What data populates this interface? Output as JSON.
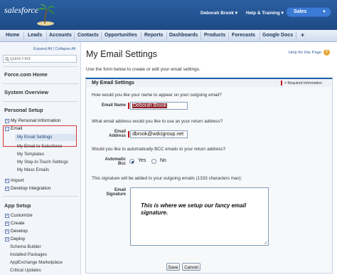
{
  "header": {
    "logo_text": "salesforce",
    "user_menu": "Deborah Brook",
    "help_menu": "Help & Training",
    "app_switcher": "Sales"
  },
  "tabs": [
    {
      "label": "Home"
    },
    {
      "label": "Leads"
    },
    {
      "label": "Accounts"
    },
    {
      "label": "Contacts"
    },
    {
      "label": "Opportunities"
    },
    {
      "label": "Reports"
    },
    {
      "label": "Dashboards"
    },
    {
      "label": "Products"
    },
    {
      "label": "Forecasts"
    },
    {
      "label": "Google Docs"
    },
    {
      "label": "+"
    }
  ],
  "sidebar": {
    "expand_all": "Expand All",
    "collapse_all": "Collapse All",
    "search_placeholder": "Quick Find",
    "sections": {
      "forcecom_home": "Force.com Home",
      "system_overview": "System Overview",
      "personal_setup": "Personal Setup",
      "app_setup": "App Setup"
    },
    "personal_items": {
      "my_personal_information": "My Personal Information",
      "email": "Email",
      "my_email_settings": "My Email Settings",
      "my_email_to_salesforce": "My Email to Salesforce",
      "my_templates": "My Templates",
      "my_stay_in_touch_settings": "My Stay-in-Touch Settings",
      "my_mass_emails": "My Mass Emails",
      "import": "Import",
      "desktop_integration": "Desktop Integration"
    },
    "app_items": {
      "customize": "Customize",
      "create": "Create",
      "develop": "Develop",
      "deploy": "Deploy",
      "schema_builder": "Schema Builder",
      "installed_packages": "Installed Packages",
      "appexchange_marketplace": "AppExchange Marketplace",
      "critical_updates": "Critical Updates"
    }
  },
  "main": {
    "title": "My Email Settings",
    "help_link": "Help for this Page",
    "intro": "Use the form below to create or edit your email settings.",
    "panel_title": "My Email Settings",
    "required_info": "= Required Information",
    "q_name": "How would you like your name to appear on your outgoing email?",
    "email_name_label": "Email Name",
    "email_name_value": "Deborah Brook",
    "q_address": "What email address would you like to use as your return address?",
    "email_address_label_1": "Email",
    "email_address_label_2": "Address",
    "email_address_value": "dbrook@wdcigroup.net",
    "q_bcc": "Would you like to automatically BCC emails to your return address?",
    "auto_bcc_label_1": "Automatic",
    "auto_bcc_label_2": "Bcc",
    "bcc_yes": "Yes",
    "bcc_no": "No",
    "bcc_selected": "Yes",
    "q_signature": "This signature will be added to your outgoing emails (1333 characters max):",
    "signature_label_1": "Email",
    "signature_label_2": "Signature",
    "signature_value": "This is where we setup our fancy email signature.",
    "save_button": "Save",
    "cancel_button": "Cancel"
  },
  "colors": {
    "header_blue": "#1d4a86",
    "panel_accent": "#1e5fa8",
    "required_red": "#c4151c",
    "highlight_box": "#d63a3a"
  }
}
